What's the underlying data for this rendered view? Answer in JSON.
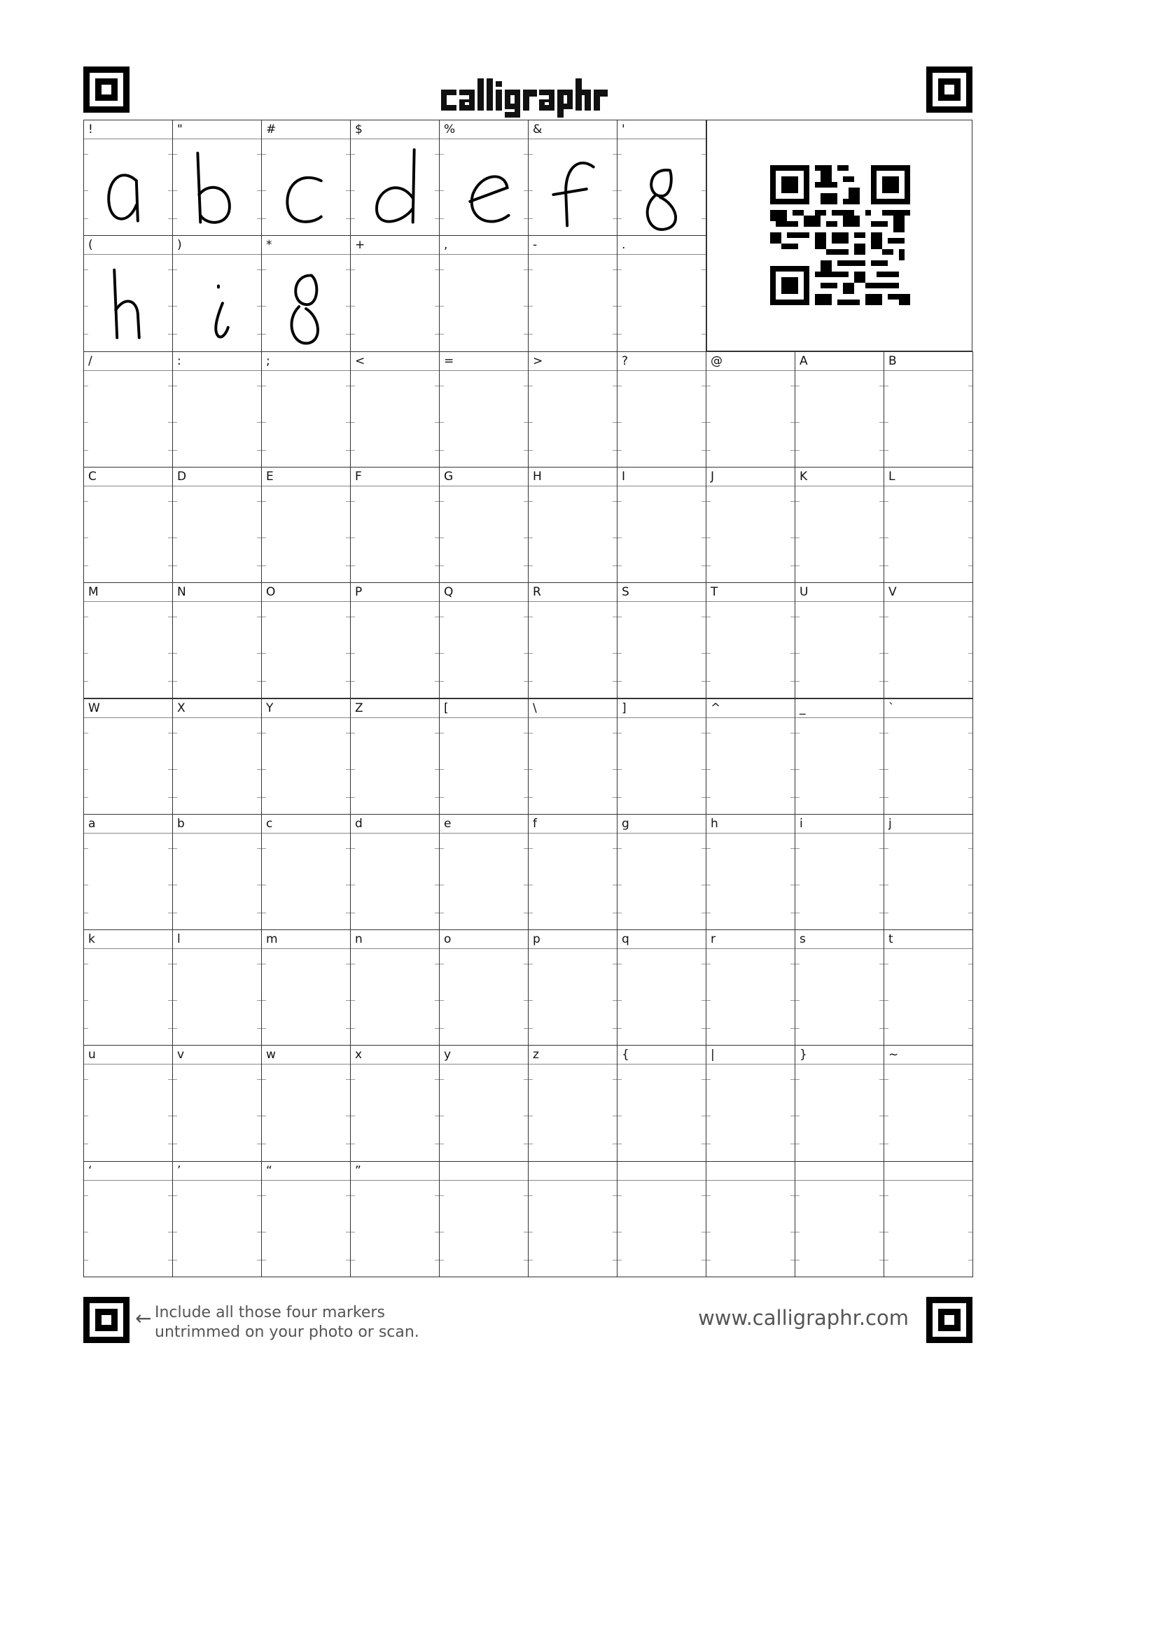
{
  "header": {
    "logo_text": "calligraphr"
  },
  "rows": [
    [
      "!",
      "\"",
      "#",
      "$",
      "%",
      "&",
      "'"
    ],
    [
      "(",
      ")",
      "*",
      "+",
      ",",
      "-",
      "."
    ],
    [
      "/",
      ":",
      ";",
      "<",
      "=",
      ">",
      "?",
      "@",
      "A",
      "B"
    ],
    [
      "C",
      "D",
      "E",
      "F",
      "G",
      "H",
      "I",
      "J",
      "K",
      "L"
    ],
    [
      "M",
      "N",
      "O",
      "P",
      "Q",
      "R",
      "S",
      "T",
      "U",
      "V"
    ],
    [
      "W",
      "X",
      "Y",
      "Z",
      "[",
      "\\",
      "]",
      "^",
      "_",
      "`"
    ],
    [
      "a",
      "b",
      "c",
      "d",
      "e",
      "f",
      "g",
      "h",
      "i",
      "j"
    ],
    [
      "k",
      "l",
      "m",
      "n",
      "o",
      "p",
      "q",
      "r",
      "s",
      "t"
    ],
    [
      "u",
      "v",
      "w",
      "x",
      "y",
      "z",
      "{",
      "|",
      "}",
      "~"
    ],
    [
      "‘",
      "’",
      "“",
      "”",
      "",
      "",
      "",
      "",
      "",
      ""
    ]
  ],
  "handwritten": [
    [
      "a",
      "b",
      "c",
      "d",
      "e",
      "f",
      "g"
    ],
    [
      "h",
      "i",
      "g",
      "",
      "",
      "",
      ""
    ]
  ],
  "qr_icon": "qr-code",
  "footer": {
    "instruction_line1": "Include all those four markers",
    "instruction_line2": "untrimmed on your photo or scan.",
    "arrow": "←",
    "url": "www.calligraphr.com"
  }
}
